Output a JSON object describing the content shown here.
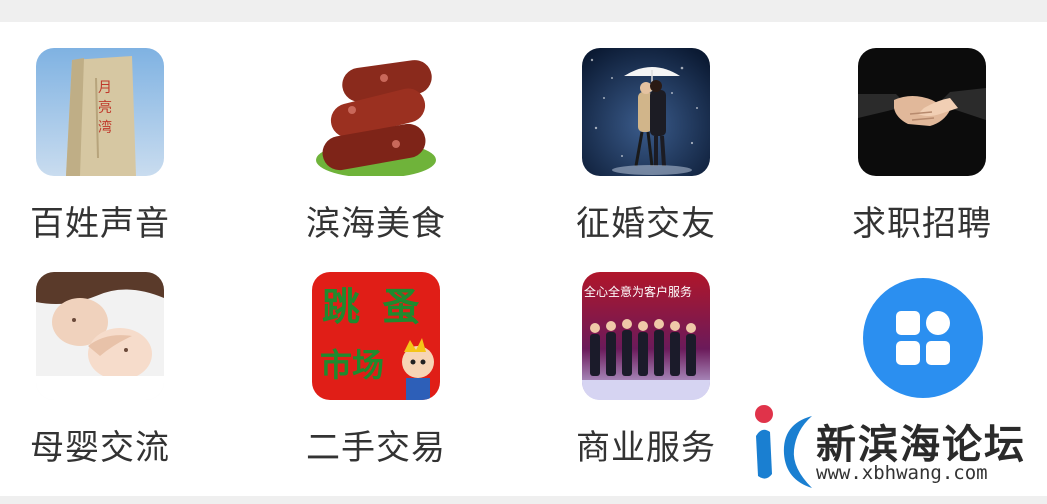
{
  "colors": {
    "accent": "#2b8ff0",
    "page_bg": "#efefef",
    "label_text": "#333333"
  },
  "grid": {
    "items": [
      {
        "label": "百姓声音",
        "icon": "monument-stone-icon"
      },
      {
        "label": "滨海美食",
        "icon": "sausage-food-icon"
      },
      {
        "label": "征婚交友",
        "icon": "couple-umbrella-icon"
      },
      {
        "label": "求职招聘",
        "icon": "handshake-icon"
      },
      {
        "label": "母婴交流",
        "icon": "mother-baby-icon"
      },
      {
        "label": "二手交易",
        "icon": "flea-market-icon",
        "image_text": [
          "跳",
          "蚤",
          "市场"
        ]
      },
      {
        "label": "商业服务",
        "icon": "business-people-icon",
        "image_text": "全心全意为客户服务"
      },
      {
        "label": "",
        "icon": "more-grid-icon"
      }
    ]
  },
  "watermark": {
    "name": "新滨海论坛",
    "url": "www.xbhwang.com"
  }
}
